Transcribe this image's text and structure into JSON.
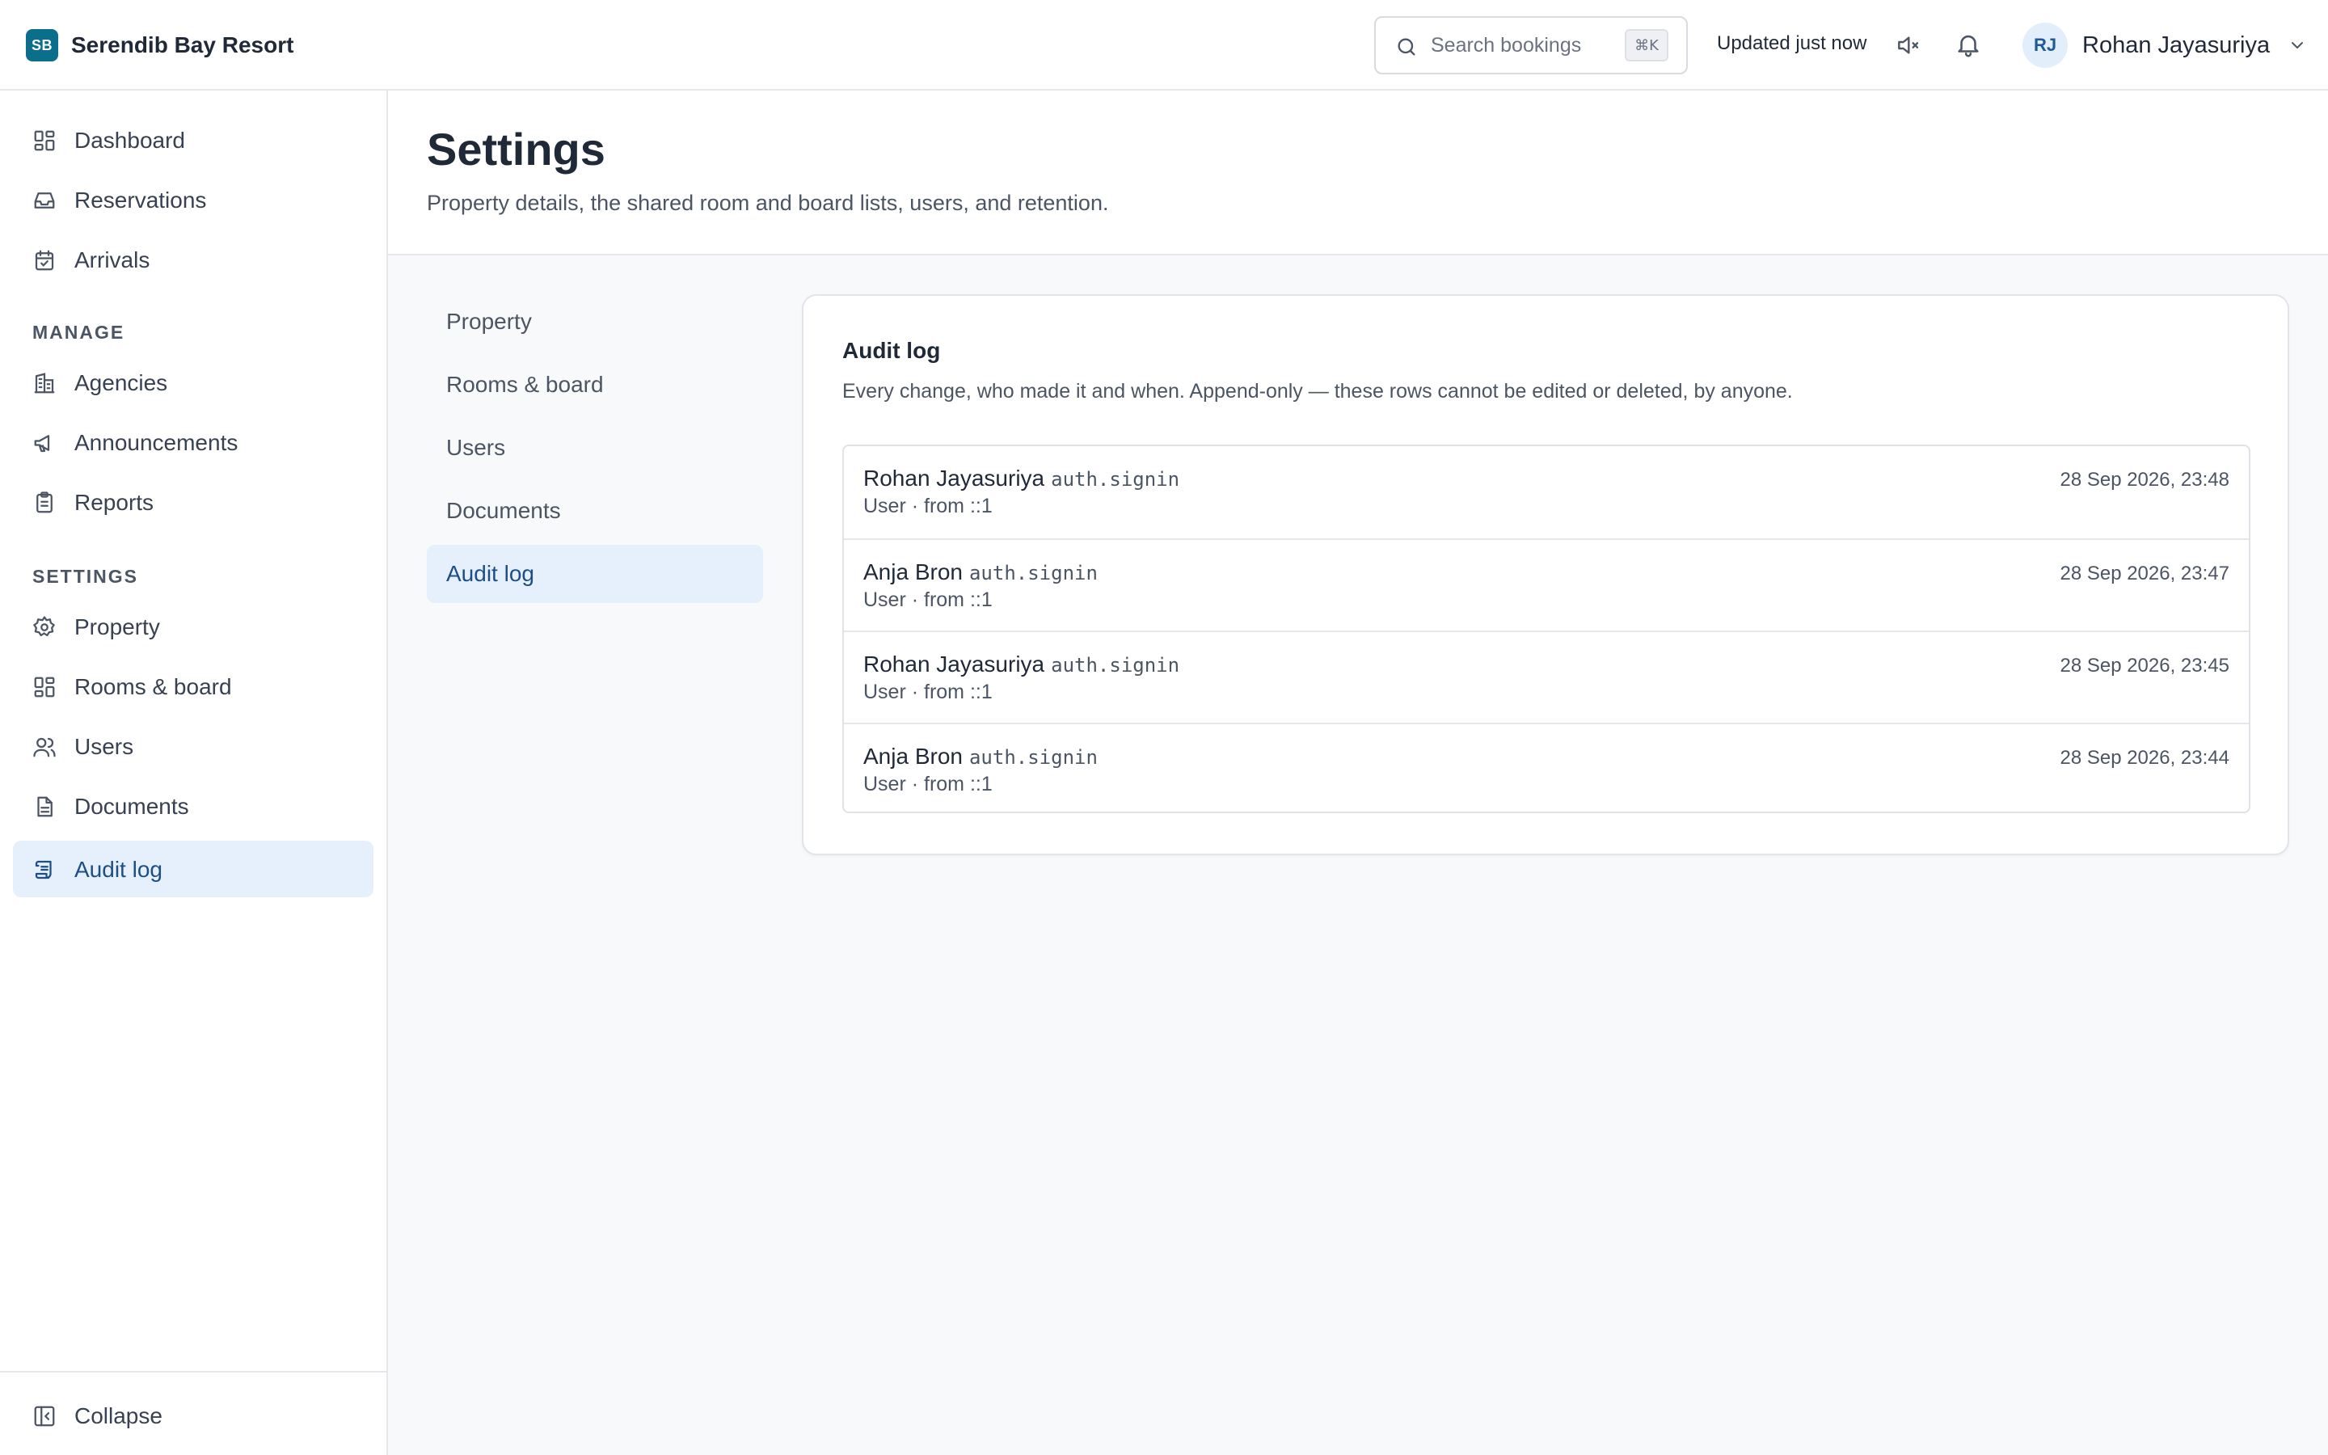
{
  "app": {
    "logo_text": "SB",
    "name": "Serendib Bay Resort"
  },
  "header": {
    "search_placeholder": "Search bookings",
    "search_shortcut": "⌘K",
    "updated_status": "Updated just now",
    "user_initials": "RJ",
    "user_name": "Rohan Jayasuriya"
  },
  "sidebar": {
    "items": [
      {
        "label": "Dashboard",
        "icon": "dashboard-icon"
      },
      {
        "label": "Reservations",
        "icon": "inbox-icon"
      },
      {
        "label": "Arrivals",
        "icon": "calendar-check-icon"
      }
    ],
    "manage_label": "MANAGE",
    "manage_items": [
      {
        "label": "Agencies",
        "icon": "building-icon"
      },
      {
        "label": "Announcements",
        "icon": "megaphone-icon"
      },
      {
        "label": "Reports",
        "icon": "clipboard-icon"
      }
    ],
    "settings_label": "SETTINGS",
    "settings_items": [
      {
        "label": "Property",
        "icon": "gear-icon"
      },
      {
        "label": "Rooms & board",
        "icon": "grid-icon"
      },
      {
        "label": "Users",
        "icon": "users-icon"
      },
      {
        "label": "Documents",
        "icon": "document-icon"
      },
      {
        "label": "Audit log",
        "icon": "scroll-icon"
      }
    ],
    "collapse_label": "Collapse"
  },
  "page": {
    "title": "Settings",
    "subtitle": "Property details, the shared room and board lists, users, and retention."
  },
  "subnav": {
    "items": [
      "Property",
      "Rooms & board",
      "Users",
      "Documents",
      "Audit log"
    ],
    "active": "Audit log"
  },
  "audit": {
    "title": "Audit log",
    "description": "Every change, who made it and when. Append-only — these rows cannot be edited or deleted, by anyone.",
    "rows": [
      {
        "actor": "Rohan Jayasuriya",
        "action": "auth.signin",
        "meta": "User · from ::1",
        "time": "28 Sep 2026, 23:48"
      },
      {
        "actor": "Anja Bron",
        "action": "auth.signin",
        "meta": "User · from ::1",
        "time": "28 Sep 2026, 23:47"
      },
      {
        "actor": "Rohan Jayasuriya",
        "action": "auth.signin",
        "meta": "User · from ::1",
        "time": "28 Sep 2026, 23:45"
      },
      {
        "actor": "Anja Bron",
        "action": "auth.signin",
        "meta": "User · from ::1",
        "time": "28 Sep 2026, 23:44"
      }
    ]
  },
  "colors": {
    "brand": "#0b6f8c",
    "active_bg": "#e5f0fc",
    "active_text": "#1d4f86"
  }
}
